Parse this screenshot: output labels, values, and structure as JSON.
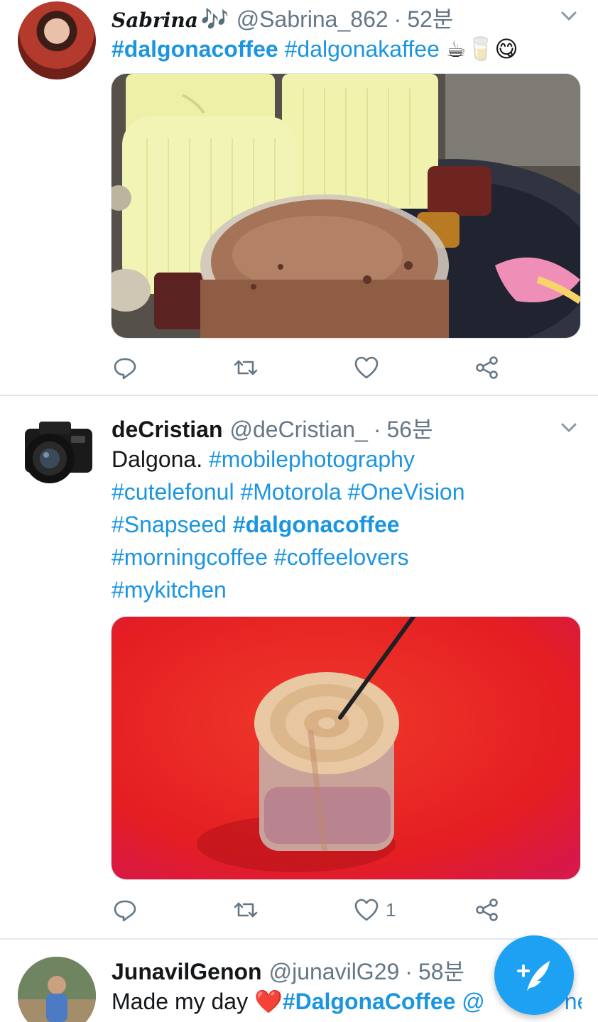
{
  "tweets": [
    {
      "name": "Sabrina",
      "name_emoji": "🎶",
      "handle": "@Sabrina_862",
      "time": "52분",
      "text_tags": [
        "#dalgonacoffee",
        "#dalgonakaffee"
      ],
      "text_emojis": "☕🥛😋",
      "media_icon": "dalgona-coffee-candles-photo",
      "actions": {
        "reply": "",
        "retweet": "",
        "like": "",
        "share": ""
      }
    },
    {
      "name": "deCristian",
      "handle": "@deCristian_",
      "time": "56분",
      "text_plain": "Dalgona.",
      "tags": [
        "#mobilephotography",
        "#cutelefonul",
        "#Motorola",
        "#OneVision",
        "#Snapseed",
        "#dalgonacoffee",
        "#morningcoffee",
        "#coffeelovers",
        "#mykitchen"
      ],
      "media_icon": "dalgona-coffee-red-background-photo",
      "actions": {
        "reply": "",
        "retweet": "",
        "like": "1",
        "share": ""
      }
    },
    {
      "name": "JunavilGenon",
      "handle": "@junavilG29",
      "time": "58분",
      "text_plain": "Made my day",
      "text_emoji": "❤️",
      "tags": [
        "#DalgonaCoffee"
      ],
      "tail": "@",
      "tail_hidden": "ne"
    }
  ],
  "separator": "·",
  "icons": {
    "reply": "reply-icon",
    "retweet": "retweet-icon",
    "like": "heart-icon",
    "share": "share-icon",
    "chevron": "chevron-down-icon",
    "compose": "compose-tweet-icon"
  },
  "colors": {
    "accent": "#1da1f2",
    "link": "#1b95e0",
    "muted": "#657786",
    "divider": "#e1e8ed"
  }
}
